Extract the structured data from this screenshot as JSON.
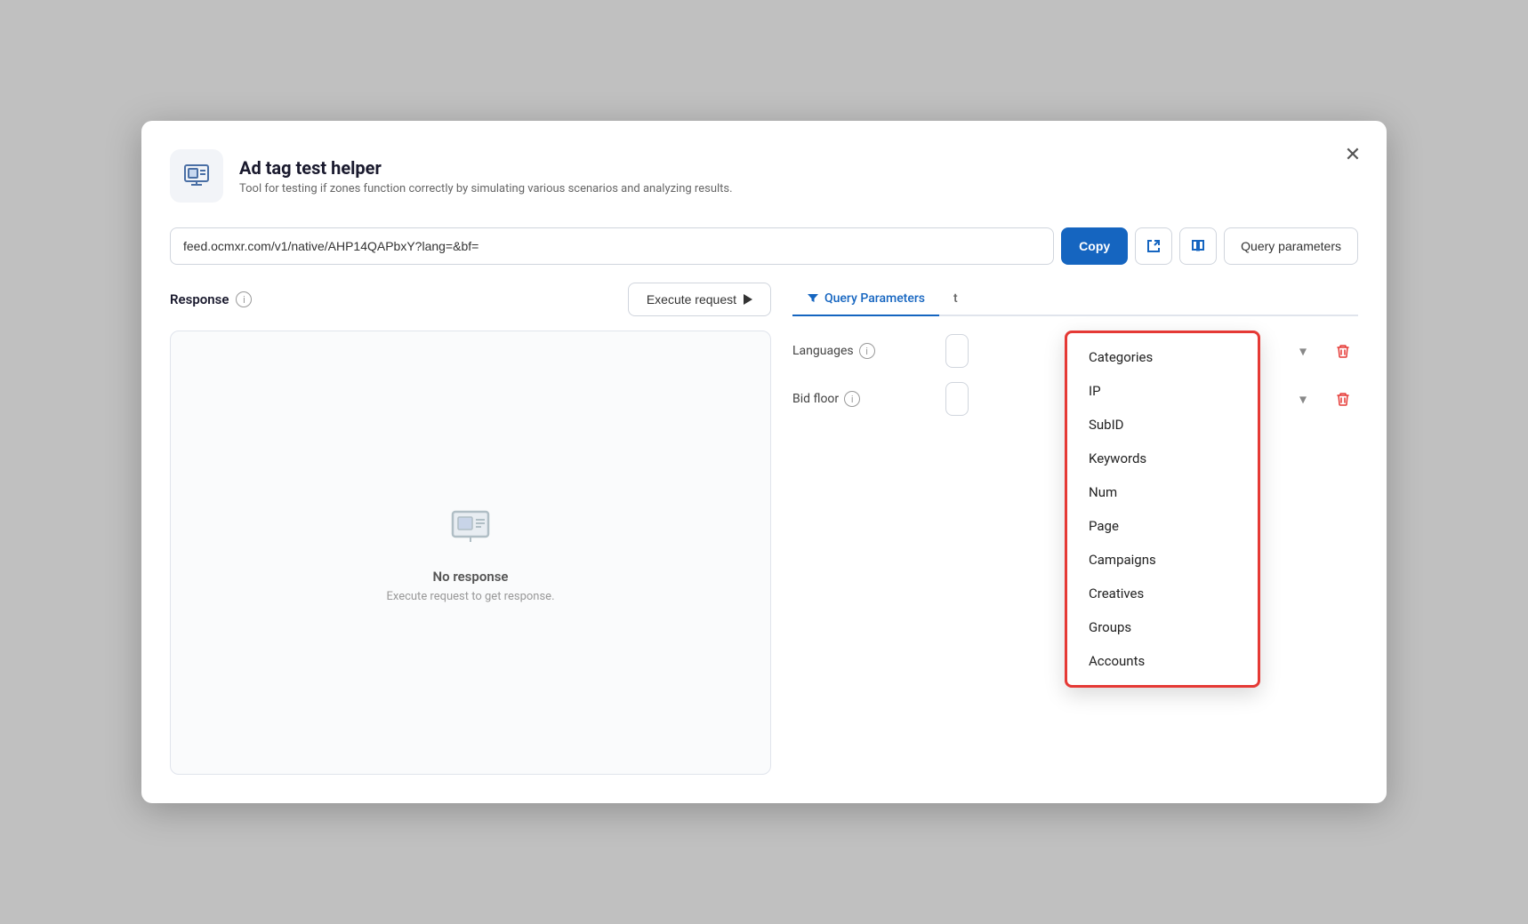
{
  "modal": {
    "title": "Ad tag test helper",
    "subtitle": "Tool for testing if zones function correctly by simulating various scenarios and analyzing results."
  },
  "toolbar": {
    "url_value": "feed.ocmxr.com/v1/native/AHP14QAPbxY?lang=&bf=",
    "copy_label": "Copy",
    "query_params_label": "Query parameters"
  },
  "response": {
    "label": "Response",
    "execute_label": "Execute request",
    "no_response_title": "No response",
    "no_response_sub": "Execute request to get response."
  },
  "tabs": [
    {
      "label": "Query Parameters",
      "active": true,
      "has_filter_icon": true
    },
    {
      "label": "t",
      "active": false
    }
  ],
  "params": [
    {
      "label": "Languages",
      "has_info": true
    },
    {
      "label": "Bid floor",
      "has_info": true
    }
  ],
  "dropdown": {
    "items": [
      "Categories",
      "IP",
      "SubID",
      "Keywords",
      "Num",
      "Page",
      "Campaigns",
      "Creatives",
      "Groups",
      "Accounts"
    ]
  },
  "icons": {
    "close": "✕",
    "play": "",
    "info": "i",
    "filter": "⚗",
    "external_link": "↗",
    "book": "📖",
    "trash": "🗑",
    "monitor": "🖥"
  }
}
